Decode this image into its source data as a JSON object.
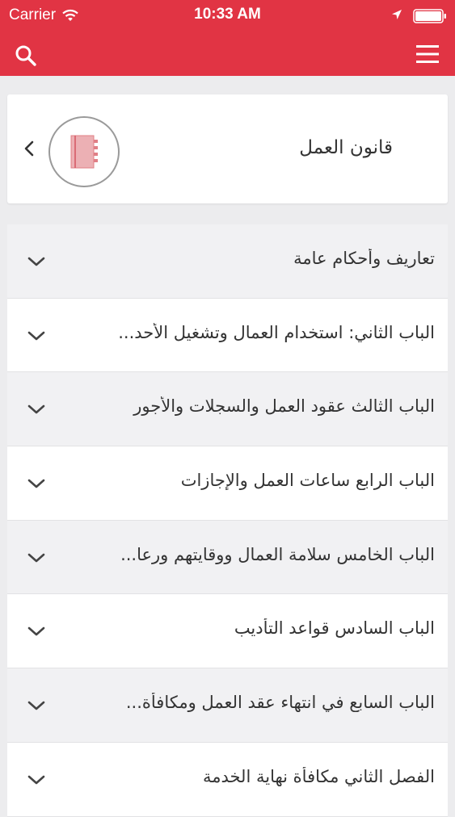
{
  "status_bar": {
    "carrier": "Carrier",
    "time": "10:33 AM"
  },
  "nav": {
    "left_icon": "search-icon",
    "right_icon": "menu-icon"
  },
  "colors": {
    "header": "#e13444",
    "background": "#ececee",
    "book_icon": "#e8a7ab"
  },
  "law_card": {
    "title": "قانون العمل",
    "icon": "book-icon",
    "chevron": "chevron-left-icon"
  },
  "chapters": [
    {
      "title": "تعاريف وأحكام عامة"
    },
    {
      "title": "الباب الثاني: استخدام العمال وتشغيل الأحد..."
    },
    {
      "title": "الباب الثالث عقود العمل والسجلات والأجور"
    },
    {
      "title": "الباب الرابع ساعات العمل والإجازات"
    },
    {
      "title": "الباب الخامس سلامة العمال ووقايتهم ورعا..."
    },
    {
      "title": "الباب السادس قواعد التأديب"
    },
    {
      "title": "الباب السابع  في انتهاء عقد العمل ومكافأة..."
    },
    {
      "title": "الفصل الثاني مكافأة نهاية الخدمة"
    }
  ]
}
